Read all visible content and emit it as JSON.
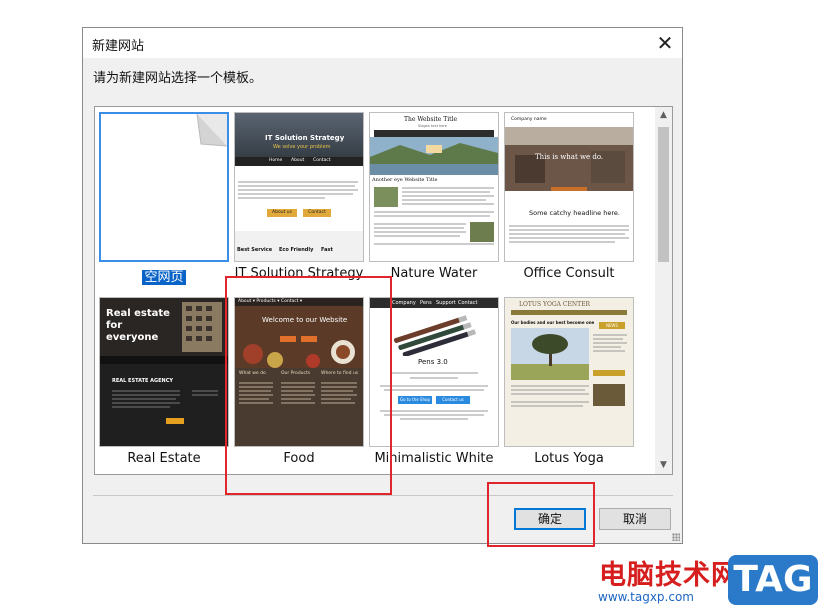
{
  "dialog": {
    "title": "新建网站",
    "close_symbol": "✕",
    "prompt": "请为新建网站选择一个模板。"
  },
  "templates": [
    {
      "label": "空网页",
      "selected": true
    },
    {
      "label": "IT Solution Strategy",
      "selected": false
    },
    {
      "label": "Nature Water",
      "selected": false
    },
    {
      "label": "Office Consult",
      "selected": false
    },
    {
      "label": "Real Estate",
      "selected": false
    },
    {
      "label": "Food",
      "selected": false
    },
    {
      "label": "Minimalistic White",
      "selected": false
    },
    {
      "label": "Lotus Yoga",
      "selected": false
    }
  ],
  "previews": {
    "it": {
      "heading": "IT Solution Strategy",
      "sub": "We solve your problem",
      "nav": [
        "Home",
        "About",
        "Contact"
      ],
      "btn1": "About us",
      "btn2": "Contact",
      "cols": [
        "Best Service",
        "Eco Friendly",
        "Fast"
      ]
    },
    "nature": {
      "heading": "The Website Title",
      "sub": "Slogan text here",
      "caption": "Another eye Website Title"
    },
    "office": {
      "company": "Company name",
      "hero": "This is what we do.",
      "catch": "Some catchy headline here."
    },
    "realestate": {
      "hero": "Real estate for everyone",
      "agency": "REAL ESTATE AGENCY"
    },
    "food": {
      "nav": "About ▾   Products ▾   Contact ▾",
      "hero": "Welcome to our Website",
      "cols": [
        "What we do",
        "Our Products",
        "Where to find us"
      ]
    },
    "minimal": {
      "nav": [
        "Company",
        "Pens",
        "Support",
        "Contact"
      ],
      "heading": "Pens 3.0",
      "btn1": "Go to the Shop",
      "btn2": "Contact us"
    },
    "yoga": {
      "heading": "LOTUS YOGA CENTER",
      "news": "NEWS",
      "subtitle": "Our bodies and our best become one"
    }
  },
  "buttons": {
    "ok": "确定",
    "cancel": "取消"
  },
  "watermark": {
    "brand": "电脑技术网",
    "url": "www.tagxp.com",
    "tag": "TAG"
  },
  "colors": {
    "selection": "#0a64c8",
    "highlight_box": "#e0262b",
    "accent": "#0078d7"
  }
}
